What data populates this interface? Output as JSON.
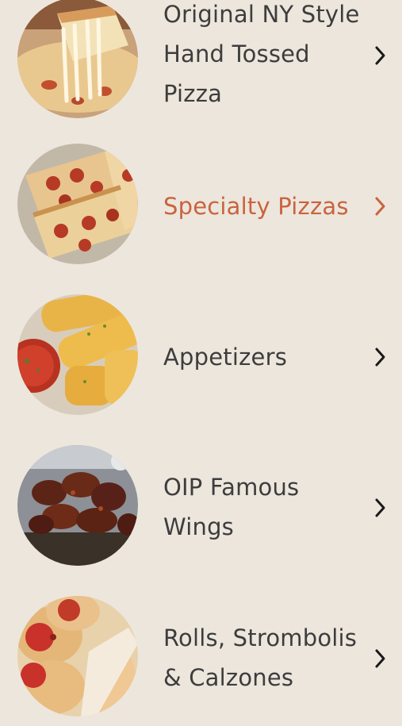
{
  "menu": {
    "categories": [
      {
        "label": "Original NY Style Hand Tossed Pizza",
        "image_icon": "cheese-pizza-slice-photo",
        "active": false
      },
      {
        "label": "Specialty Pizzas",
        "image_icon": "pepperoni-pizza-slices-photo",
        "active": true
      },
      {
        "label": "Appetizers",
        "image_icon": "breadsticks-marinara-photo",
        "active": false
      },
      {
        "label": "OIP Famous Wings",
        "image_icon": "bbq-wings-photo",
        "active": false
      },
      {
        "label": "Rolls, Strombolis & Calzones",
        "image_icon": "pepperoni-rolls-photo",
        "active": false
      }
    ],
    "chevron_icon": "chevron-right-icon"
  },
  "colors": {
    "background": "#ede6dd",
    "text": "#3d3d3d",
    "active_text": "#c8643e",
    "chevron": "#1a1a1a",
    "active_chevron": "#c8643e"
  }
}
